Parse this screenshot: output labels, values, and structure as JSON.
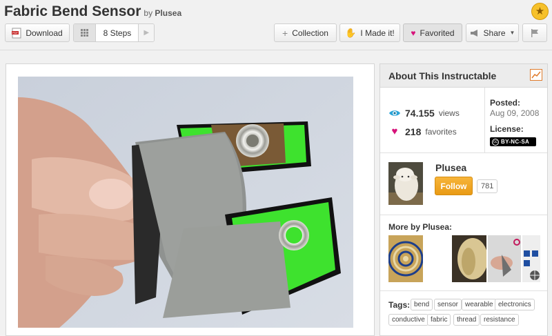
{
  "header": {
    "title": "Fabric Bend Sensor",
    "by_prefix": "by",
    "author": "Plusea"
  },
  "toolbar": {
    "download": "Download",
    "steps": "8 Steps",
    "collection": "Collection",
    "made_it": "I Made it!",
    "favorited": "Favorited",
    "share": "Share",
    "colors": {
      "heart": "#d6127a",
      "follow": "#f0a324"
    }
  },
  "sidebar": {
    "heading": "About This Instructable",
    "views_count": "74.155",
    "views_label": "views",
    "favorites_count": "218",
    "favorites_label": "favorites",
    "posted_label": "Posted:",
    "posted_date": "Aug 09, 2008",
    "license_label": "License:",
    "license_badge": "BY-NC-SA",
    "author_name": "Plusea",
    "follow_label": "Follow",
    "followers": "781",
    "more_by": "More by Plusea:",
    "tags_label": "Tags:",
    "tags": [
      "bend",
      "sensor",
      "wearable",
      "electronics",
      "conductive",
      "fabric",
      "thread",
      "resistance"
    ]
  }
}
